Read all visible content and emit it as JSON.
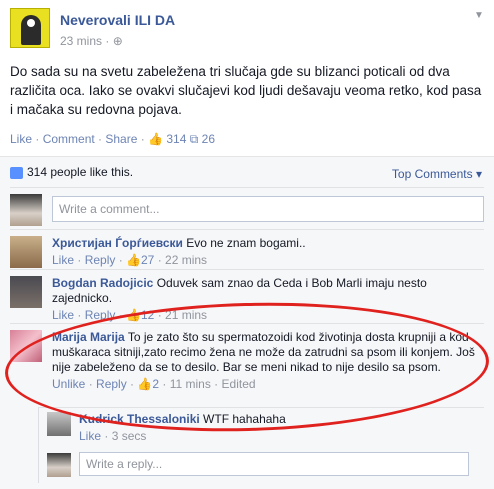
{
  "post": {
    "page_name": "Neverovali ILI DA",
    "time": "23 mins",
    "text": "Do sada su na svetu zabeležena tri slučaja gde su blizanci poticali od dva različita oca. Iako se ovakvi slučajevi kod ljudi dešavaju veoma retko, kod pasa i mačaka su redovna pojava.",
    "actions": {
      "like": "Like",
      "comment": "Comment",
      "share": "Share",
      "like_count": "314",
      "share_count": "26"
    }
  },
  "ufi": {
    "likes_summary": "314 people like this.",
    "sort_label": "Top Comments",
    "write_comment_placeholder": "Write a comment...",
    "write_reply_placeholder": "Write a reply..."
  },
  "comments": [
    {
      "name": "Христијан Ѓорѓиевски",
      "text": "Evo ne znam bogami..",
      "like": "Like",
      "reply": "Reply",
      "likes": "27",
      "time": "22 mins"
    },
    {
      "name": "Bogdan Radojicic",
      "text": "Oduvek sam znao da Ceda i Bob Marli imaju nesto zajednicko.",
      "like": "Like",
      "reply": "Reply",
      "likes": "12",
      "time": "21 mins"
    },
    {
      "name": "Marija Marija",
      "text": "To je zato što su spermatozoidi kod životinja dosta krupniji a kod muškaraca sitniji,zato recimo žena ne može da zatrudni sa psom ili konjem. Još nije zabeleženo da se to desilo. Bar se meni nikad to nije desilo sa psom.",
      "unlike": "Unlike",
      "reply": "Reply",
      "likes": "2",
      "time": "11 mins",
      "edited": "Edited"
    }
  ],
  "reply": {
    "name": "Kudrick Thessaloniki",
    "text": "WTF hahahaha",
    "like": "Like",
    "time": "3 secs"
  },
  "colors": {
    "brand": "#3b5998",
    "link": "#6d84b4",
    "highlight": "#e0221f"
  }
}
